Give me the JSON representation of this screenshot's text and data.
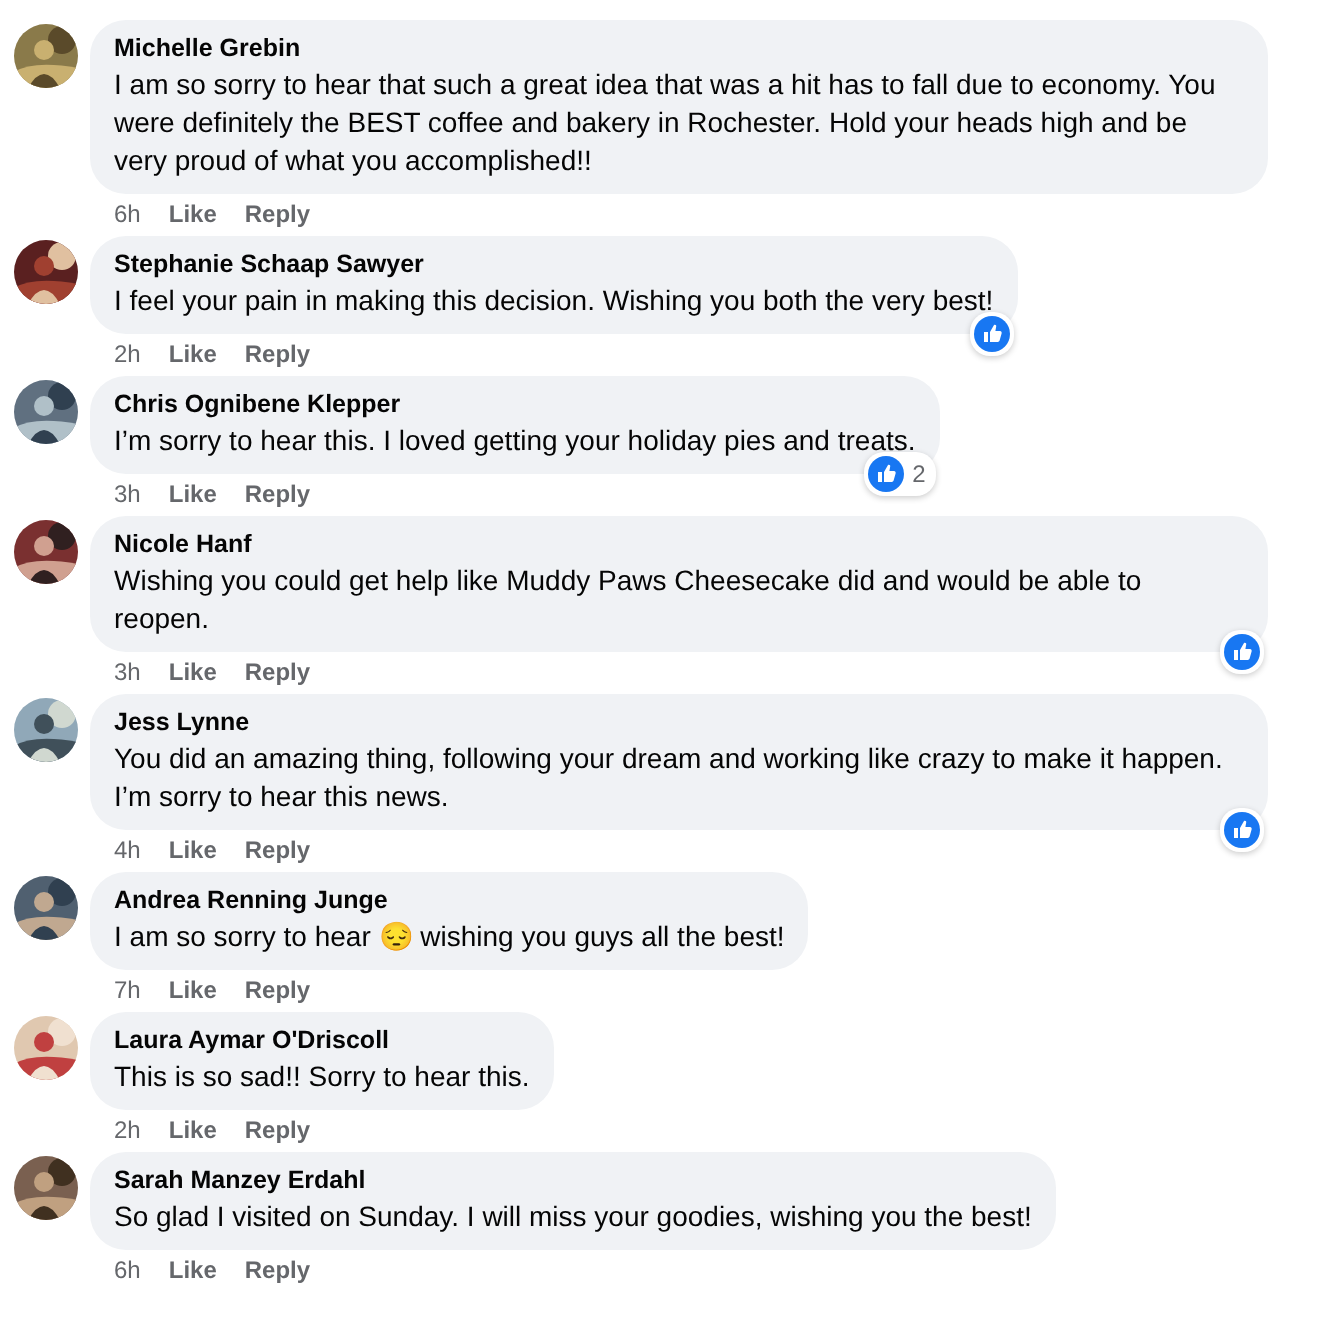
{
  "comments": [
    {
      "author": "Michelle Grebin",
      "text": "I am so sorry to hear that such a great idea that was a hit has to fall due to economy. You were definitely the BEST coffee and bakery in Rochester. Hold your heads high and be very proud of what you accomplished!!",
      "time": "6h",
      "like": "Like",
      "reply": "Reply",
      "reacted": false
    },
    {
      "author": "Stephanie Schaap Sawyer",
      "text": "I feel your pain in making this decision. Wishing you both the very best!",
      "time": "2h",
      "like": "Like",
      "reply": "Reply",
      "reacted": true
    },
    {
      "author": "Chris Ognibene Klepper",
      "text": "I’m sorry to hear this. I loved getting your holiday pies and treats.",
      "time": "3h",
      "like": "Like",
      "reply": "Reply",
      "reacted": true,
      "reaction_count": "2"
    },
    {
      "author": "Nicole Hanf",
      "text": "Wishing you could get help like Muddy Paws Cheesecake did and would be able to reopen.",
      "time": "3h",
      "like": "Like",
      "reply": "Reply",
      "reacted": true
    },
    {
      "author": "Jess Lynne",
      "text": "You did an amazing thing, following your dream and working like crazy to make it happen. I’m sorry to hear this news.",
      "time": "4h",
      "like": "Like",
      "reply": "Reply",
      "reacted": true
    },
    {
      "author": "Andrea Renning Junge",
      "text": "I am so sorry to hear 😔 wishing you guys all the best!",
      "time": "7h",
      "like": "Like",
      "reply": "Reply",
      "reacted": false
    },
    {
      "author": "Laura Aymar O'Driscoll",
      "text": "This is so sad!! Sorry to hear this.",
      "time": "2h",
      "like": "Like",
      "reply": "Reply",
      "reacted": false
    },
    {
      "author": "Sarah Manzey Erdahl",
      "text": "So glad I visited on Sunday. I will miss your goodies, wishing you the best!",
      "time": "6h",
      "like": "Like",
      "reply": "Reply",
      "reacted": false
    }
  ]
}
